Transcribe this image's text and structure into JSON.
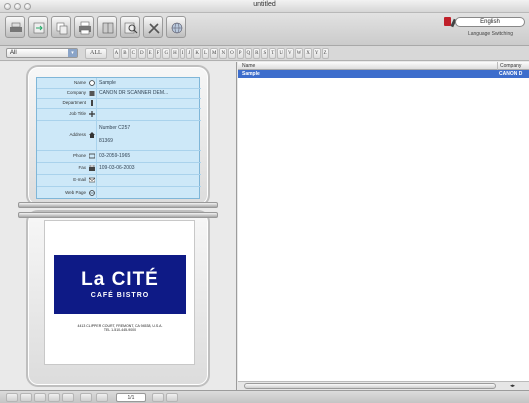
{
  "window": {
    "title": "untitled"
  },
  "toolbar": {
    "language_button": "English",
    "language_switch_label": "Language Switching"
  },
  "filter": {
    "group_selected": "All",
    "index_all": "ALL",
    "index_letters": [
      "A",
      "B",
      "C",
      "D",
      "E",
      "F",
      "G",
      "H",
      "I",
      "J",
      "K",
      "L",
      "M",
      "N",
      "O",
      "P",
      "Q",
      "R",
      "S",
      "T",
      "U",
      "V",
      "W",
      "X",
      "Y",
      "Z"
    ]
  },
  "card_info": {
    "name_label": "Name",
    "name_value": "Sample",
    "company_label": "Company",
    "company_value": "CANON DR SCANNER DEM...",
    "department_label": "Department",
    "department_value": "",
    "jobtitle_label": "Job Title",
    "jobtitle_value": "",
    "address_label": "Address",
    "address_line1": "Number C257",
    "address_line2": "81369",
    "phone_label": "Phone",
    "phone_value": "03-2059-1965",
    "fax_label": "Fax",
    "fax_value": "109-03-06-2003",
    "email_label": "E-mail",
    "email_value": "",
    "webpage_label": "Web Page",
    "webpage_value": ""
  },
  "business_card": {
    "logo_main": "La CITÉ",
    "logo_sub": "CAFÉ  BISTRO",
    "address_line1": "4413 CLIPPER COURT, FREMONT, CA 94538, U.S.A.",
    "address_line2": "TEL 1-510-445-9000"
  },
  "list": {
    "columns": [
      "Name",
      "Company"
    ],
    "rows": [
      {
        "name": "Sample",
        "company": "CANON D"
      }
    ]
  },
  "status": {
    "page_indicator": "1/1"
  },
  "colors": {
    "selection": "#3d6dcc",
    "card_logo_bg": "#0e1a86",
    "info_bg": "#cde8f8"
  }
}
